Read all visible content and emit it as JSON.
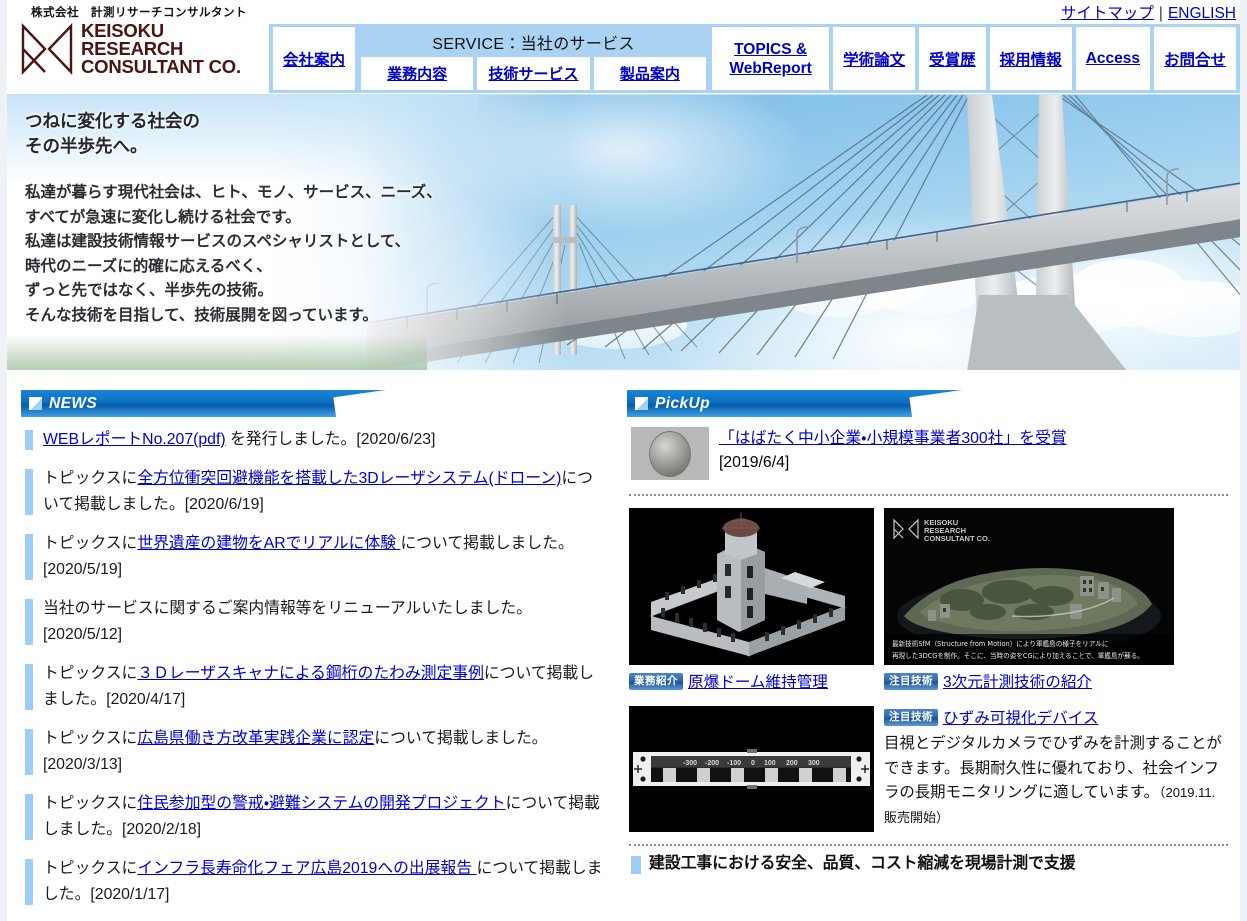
{
  "header": {
    "company_kana": "株式会社　計測リサーチコンサルタント",
    "logo_line1": "KEISOKU",
    "logo_line2": "RESEARCH",
    "logo_line3": "CONSULTANT CO.",
    "toplinks": {
      "sitemap": "サイトマップ",
      "separator": "|",
      "english": "ENGLISH"
    },
    "nav": {
      "company": "会社案内",
      "service_title": "SERVICE：当社のサービス",
      "service_items": [
        "業務内容",
        "技術サービス",
        "製品案内"
      ],
      "topics": "TOPICS & WebReport",
      "topics_line1": "TOPICS &",
      "topics_line2": "WebReport",
      "papers": "学術論文",
      "awards": "受賞歴",
      "recruit": "採用情報",
      "access": "Access",
      "contact": "お問合せ"
    }
  },
  "hero": {
    "headline_line1": "つねに変化する社会の",
    "headline_line2": "その半歩先へ。",
    "body_lines": [
      "私達が暮らす現代社会は、ヒト、モノ、サービス、ニーズ、",
      "すべてが急速に変化し続ける社会です。",
      "私達は建設技術情報サービスのスペシャリストとして、",
      "時代のニーズに的確に応えるべく、",
      "ずっと先ではなく、半歩先の技術。",
      "そんな技術を目指して、技術展開を図っています。"
    ],
    "image_alt": "cable-stayed-bridge-photo"
  },
  "news": {
    "heading": "NEWS",
    "items": [
      {
        "pre": "",
        "link": "WEBレポートNo.207(pdf)",
        "post": " を発行しました。[2020/6/23]"
      },
      {
        "pre": "トピックスに",
        "link": "全方位衝突回避機能を搭載した3Dレーザシステム(ドローン)",
        "post": "について掲載しました。[2020/6/19]"
      },
      {
        "pre": "トピックスに",
        "link": "世界遺産の建物をARでリアルに体験 ",
        "post": "について掲載しました。[2020/5/19]"
      },
      {
        "pre": "当社のサービスに関するご案内情報等をリニューアルいたしました。[2020/5/12]",
        "link": "",
        "post": ""
      },
      {
        "pre": "トピックスに",
        "link": "３Ｄレーザスキャナによる鋼桁のたわみ測定事例",
        "post": "について掲載しました。[2020/4/17]"
      },
      {
        "pre": "トピックスに",
        "link": "広島県働き方改革実践企業に認定",
        "post": "について掲載しました。[2020/3/13]"
      },
      {
        "pre": "トピックスに",
        "link": "住民参加型の警戒・避難システムの開発プロジェクト",
        "post": "について掲載しました。[2020/2/18]"
      },
      {
        "pre": "トピックスに",
        "link": "インフラ長寿命化フェア広島2019への出展報告 ",
        "post": "について掲載しました。[2020/1/17]"
      }
    ]
  },
  "pickup": {
    "heading": "PickUp",
    "award": {
      "thumb_alt": "award-medal-photo",
      "link": "「はばたく中小企業・小規模事業者300社」を受賞",
      "date": "[2019/6/4]"
    },
    "cards": [
      {
        "badge": "業務紹介",
        "title": "原爆ドーム維持管理",
        "image_alt": "atomic-bomb-dome-3d-model"
      },
      {
        "badge": "注目技術",
        "title": "3次元計測技術の紹介",
        "image_alt": "gunkanjima-3d-model",
        "watermark_line1": "KEISOKU",
        "watermark_line2": "RESEARCH",
        "watermark_line3": "CONSULTANT CO.",
        "overlay_line1": "最新技術SfM（Structure from Motion）により軍艦島の様子をリアルに",
        "overlay_line2": "再現した3DCGを制作。そこに、当時の姿をCGにより加えることで、軍艦島が蘇る。"
      }
    ],
    "strain": {
      "badge": "注目技術",
      "title": "ひずみ可視化デバイス",
      "description": "目視とデジタルカメラでひずみを計測することができます。長期耐久性に優れており、社会インフラの長期モニタリングに適しています。",
      "note": "（2019.11.販売開始）",
      "image_alt": "strain-visualization-device-photo",
      "scale_ticks": [
        "-300",
        "-200",
        "-100",
        "0",
        "100",
        "200",
        "300"
      ]
    },
    "bottom_item": "建設工事における安全、品質、コスト縮減を現場計測で支援"
  },
  "colors": {
    "nav_bg": "#a9d2f3",
    "link": "#0000cc",
    "ribbon_blue": "#0b6fc4",
    "accent_bar": "#9ccdf5",
    "logo_maroon": "#4a1410",
    "badge_blue": "#2e66ab"
  }
}
